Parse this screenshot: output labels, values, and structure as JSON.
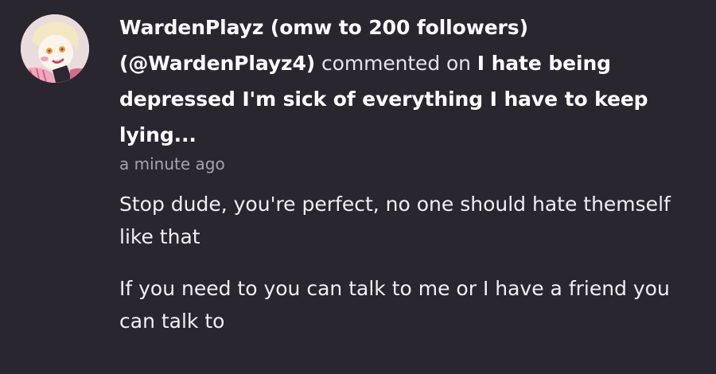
{
  "notification": {
    "avatar_icon": "user-avatar-pink-haired-character",
    "author_name": "WardenPlayz (omw to 200 followers)",
    "author_handle": "(@WardenPlayz4)",
    "action_text": "commented on",
    "post_title": "I hate being depressed I'm sick of everything I have to keep lying...",
    "timestamp": "a minute ago",
    "comment_paragraphs": [
      "Stop dude, you're perfect, no one should hate themself like that",
      "If you need to you can talk to me or I have a friend you can talk to"
    ]
  },
  "colors": {
    "background": "#292630",
    "text": "#ffffff",
    "muted_text": "#a7a3ae"
  }
}
